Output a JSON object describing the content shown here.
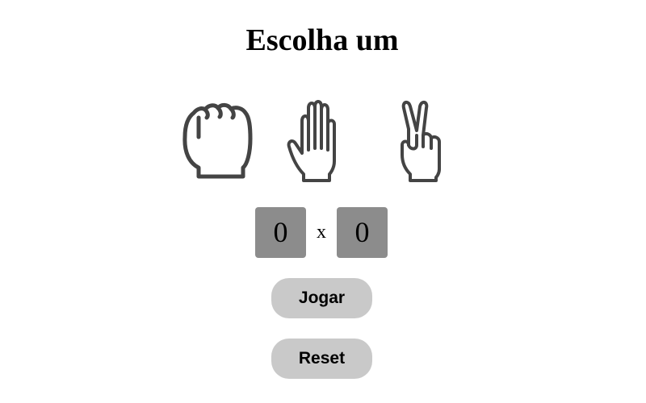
{
  "title": "Escolha um",
  "choices": [
    {
      "name": "rock",
      "icon": "fist-icon"
    },
    {
      "name": "paper",
      "icon": "open-hand-icon"
    },
    {
      "name": "scissors",
      "icon": "peace-hand-icon"
    }
  ],
  "score": {
    "player": "0",
    "separator": "x",
    "cpu": "0"
  },
  "buttons": {
    "play_label": "Jogar",
    "reset_label": "Reset"
  },
  "colors": {
    "icon_stroke": "#444444",
    "score_box": "#8c8c8c",
    "button_bg": "#c9c9c9"
  }
}
